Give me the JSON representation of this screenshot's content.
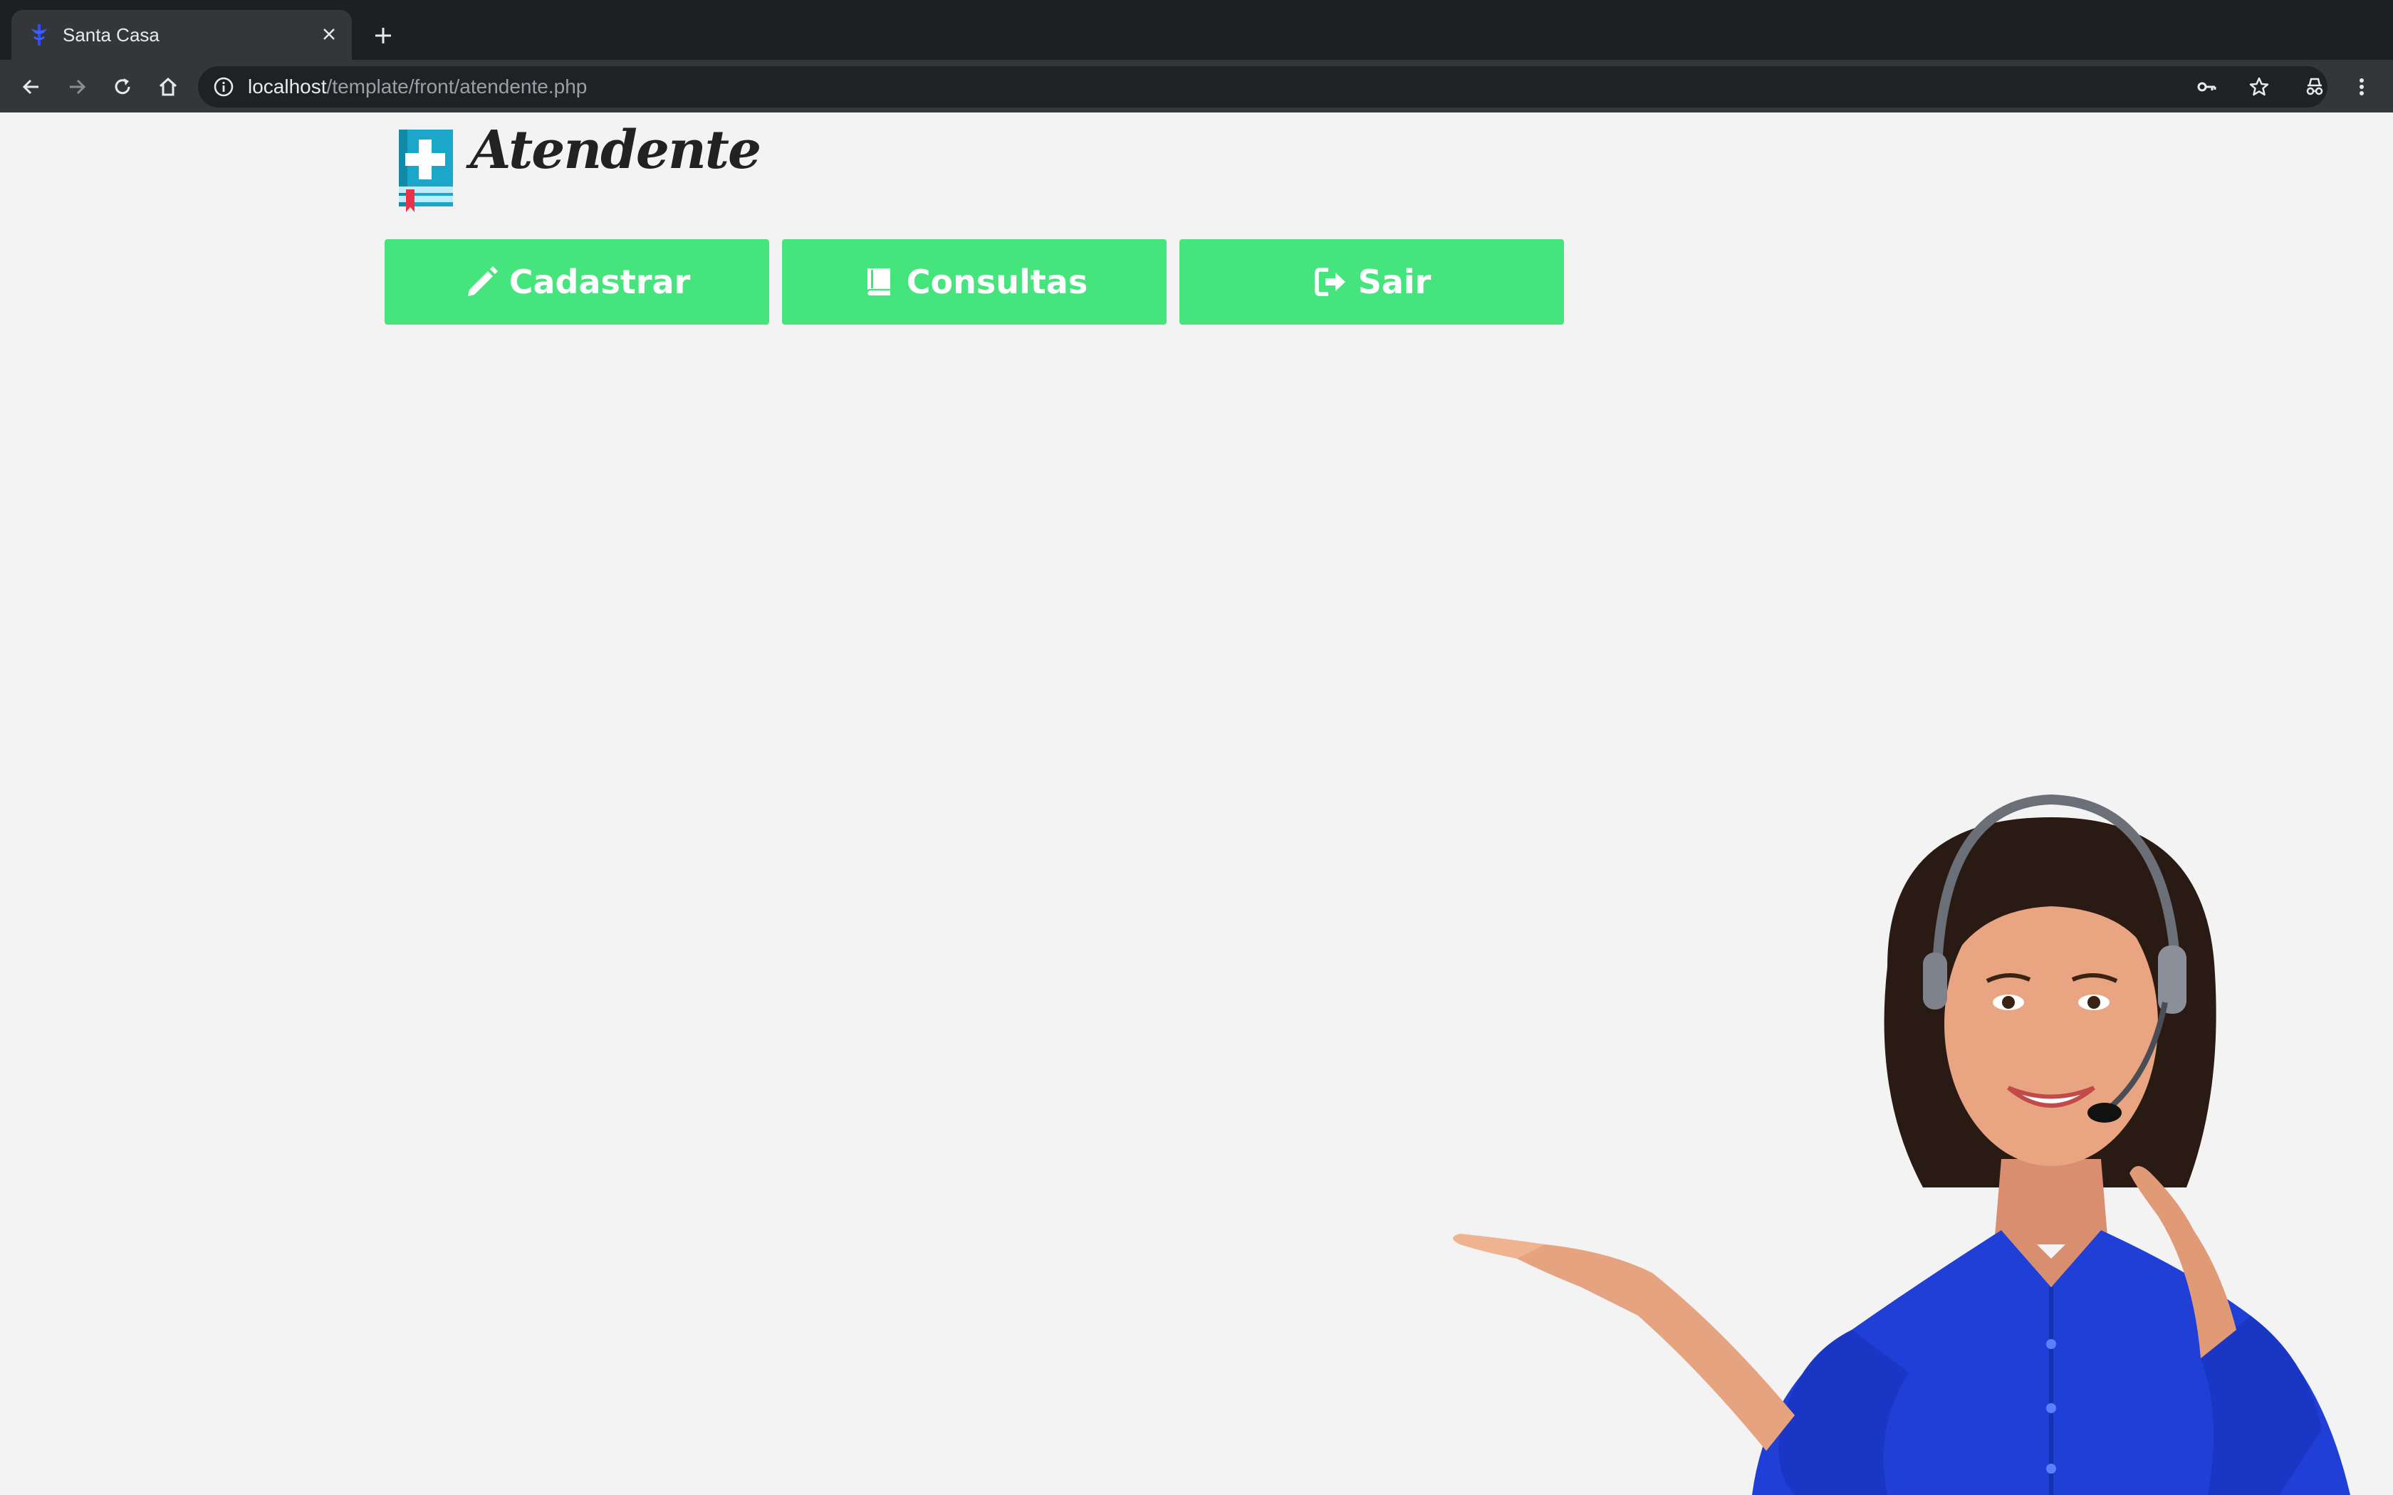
{
  "browser": {
    "tab": {
      "title": "Santa Casa",
      "close_icon": "close-icon",
      "favicon": "caduceus-icon"
    },
    "new_tab_icon": "plus-icon",
    "nav": {
      "back_icon": "arrow-left-icon",
      "forward_icon": "arrow-right-icon",
      "reload_icon": "reload-icon",
      "home_icon": "home-icon"
    },
    "address": {
      "host": "localhost",
      "path": "/template/front/atendente.php",
      "info_icon": "info-icon"
    },
    "right_icons": [
      "key-icon",
      "star-icon",
      "incognito-icon",
      "kebab-menu-icon"
    ]
  },
  "header": {
    "logo_icon": "medical-book-icon",
    "title": "Atendente"
  },
  "nav_buttons": [
    {
      "label": "Cadastrar",
      "icon": "pencil-icon"
    },
    {
      "label": "Consultas",
      "icon": "book-icon"
    },
    {
      "label": "Sair",
      "icon": "sign-out-icon"
    }
  ],
  "colors": {
    "button_bg": "#46e47c",
    "button_text": "#ffffff",
    "page_bg": "#f3f3f3",
    "shirt": "#1f3fd6"
  },
  "illustration": "customer-service-attendant-with-headset"
}
